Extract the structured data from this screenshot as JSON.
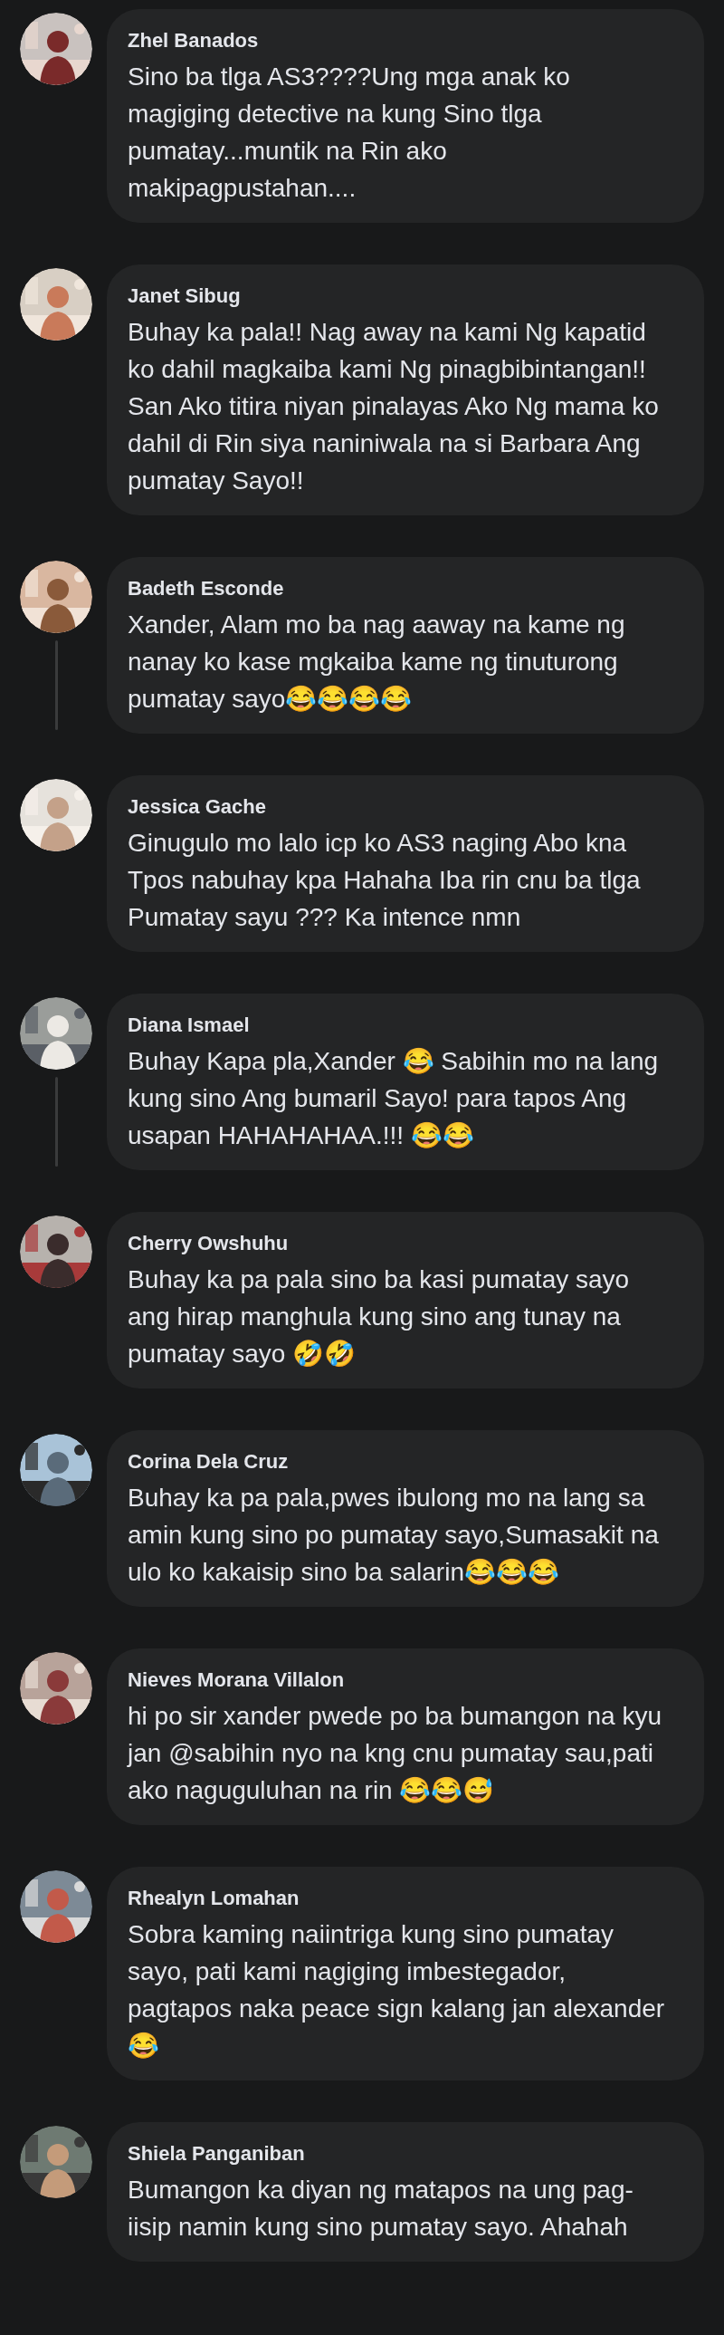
{
  "comments": [
    {
      "name": "Zhel Banados",
      "text": "Sino ba tlga AS3????Ung mga anak ko magiging detective na kung Sino tlga pumatay...muntik na Rin ako makipagpustahan....",
      "has_replies": false
    },
    {
      "name": "Janet Sibug",
      "text": "Buhay ka pala!! Nag away na kami Ng kapatid ko dahil magkaiba kami Ng pinagbibintangan!! San Ako titira niyan pinalayas Ako Ng mama ko dahil di Rin siya naniniwala na si Barbara Ang pumatay Sayo!!",
      "has_replies": false
    },
    {
      "name": "Badeth Esconde",
      "text": "Xander, Alam mo ba nag aaway na kame ng nanay ko kase mgkaiba kame ng tinuturong pumatay sayo😂😂😂😂",
      "has_replies": true
    },
    {
      "name": "Jessica Gache",
      "text": "Ginugulo mo lalo icp ko AS3 naging Abo kna Tpos nabuhay kpa Hahaha Iba rin cnu ba tlga Pumatay sayu ??? Ka intence nmn",
      "has_replies": false
    },
    {
      "name": "Diana Ismael",
      "text": "Buhay Kapa pla,Xander 😂 Sabihin mo na lang kung sino Ang bumaril Sayo! para tapos Ang usapan HAHAHAHAA.!!! 😂😂",
      "has_replies": true
    },
    {
      "name": "Cherry Owshuhu",
      "text": "Buhay ka pa pala sino ba kasi pumatay sayo ang hirap manghula kung sino ang tunay na pumatay sayo 🤣🤣",
      "has_replies": false
    },
    {
      "name": "Corina Dela Cruz",
      "text": "Buhay ka pa pala,pwes ibulong mo na lang sa amin kung sino po pumatay sayo,Sumasakit na ulo ko kakaisip sino ba salarin😂😂😂",
      "has_replies": false
    },
    {
      "name": "Nieves Morana Villalon",
      "text": "hi po sir xander pwede po ba bumangon na kyu jan @sabihin nyo na kng cnu pumatay sau,pati ako naguguluhan na rin 😂😂😅",
      "has_replies": false
    },
    {
      "name": "Rhealyn Lomahan",
      "text": "Sobra kaming naiintriga kung sino pumatay sayo, pati kami nagiging imbestegador, pagtapos naka peace sign kalang jan alexander😂",
      "has_replies": false
    },
    {
      "name": "Shiela Panganiban",
      "text": "Bumangon ka diyan ng matapos na ung pag-iisip namin kung sino pumatay sayo. Ahahah",
      "has_replies": false
    }
  ]
}
